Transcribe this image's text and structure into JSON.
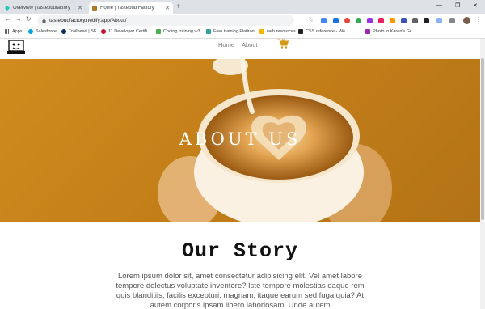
{
  "browser": {
    "tabs": [
      {
        "title": "Overview | tastebudfactory",
        "active": false
      },
      {
        "title": "Home | Tastebud Factory",
        "active": true
      }
    ],
    "new_tab_label": "+",
    "url": "tastebudfactory.netlify.app/About/",
    "bookmarks": [
      {
        "label": "Apps",
        "color": "#5f6368"
      },
      {
        "label": "Salesforce",
        "color": "#00a1e0"
      },
      {
        "label": "Trailhead | SF",
        "color": "#032e61"
      },
      {
        "label": "11 Developer Certifi...",
        "color": "#c8102e"
      },
      {
        "label": "Coding training w3",
        "color": "#4caf50"
      },
      {
        "label": "Free training Flatiron",
        "color": "#34a0a4"
      },
      {
        "label": "web resources",
        "color": "#f4b400"
      },
      {
        "label": "CSS reference - We...",
        "color": "#202124"
      },
      {
        "label": "Photo in Karen's Gr...",
        "color": "#9c27b0"
      }
    ]
  },
  "site": {
    "nav": {
      "home": "Home",
      "about": "About",
      "cart_count": "0"
    },
    "hero": {
      "title": "ABOUT US"
    },
    "story": {
      "title": "Our Story",
      "text": "Lorem ipsum dolor sit, amet consectetur adipisicing elit. Vel amet labore tempore delectus voluptate inventore? Iste tempore molestias eaque rem quis blanditiis, facilis excepturi, magnam, itaque earum sed fuga quia? At autem corporis ipsam libero laboriosam! Unde autem"
    }
  },
  "colors": {
    "accent": "#d39a1a",
    "hero_overlay": "#d5901f"
  }
}
